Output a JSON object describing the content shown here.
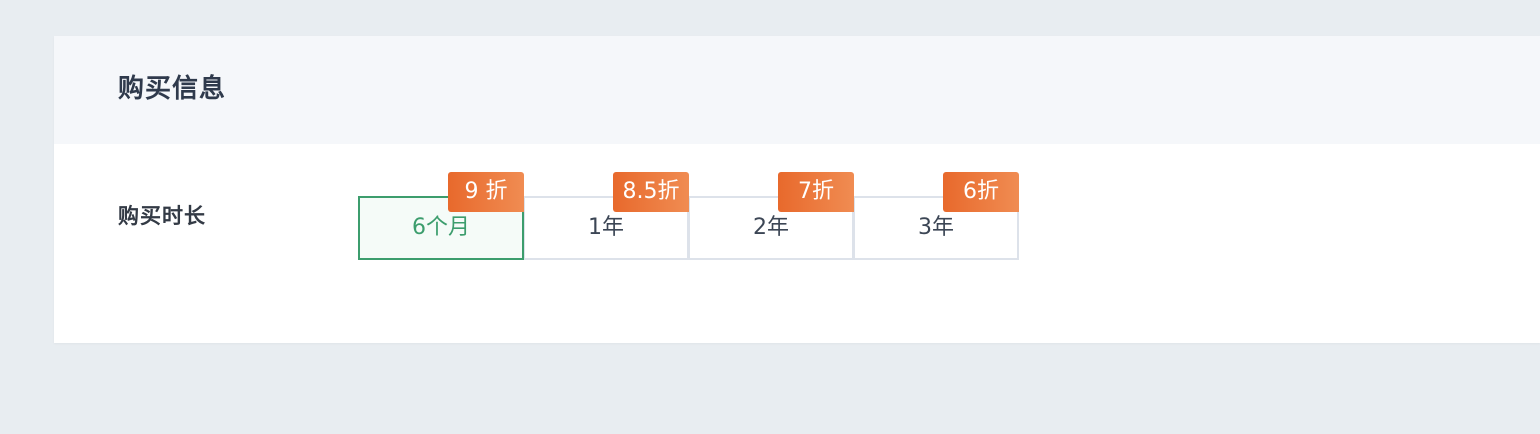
{
  "panel": {
    "title": "购买信息"
  },
  "form": {
    "duration_label": "购买时长"
  },
  "duration_options": [
    {
      "label": "6个月",
      "discount": "9 折",
      "selected": true
    },
    {
      "label": "1年",
      "discount": "8.5折",
      "selected": false
    },
    {
      "label": "2年",
      "discount": "7折",
      "selected": false
    },
    {
      "label": "3年",
      "discount": "6折",
      "selected": false
    }
  ],
  "colors": {
    "page_bg": "#e8edf1",
    "panel_header_bg": "#f5f7fa",
    "selected_border": "#3c9d6d",
    "badge_start": "#e8692c",
    "badge_end": "#f08c52",
    "text": "#2f3a4c"
  }
}
